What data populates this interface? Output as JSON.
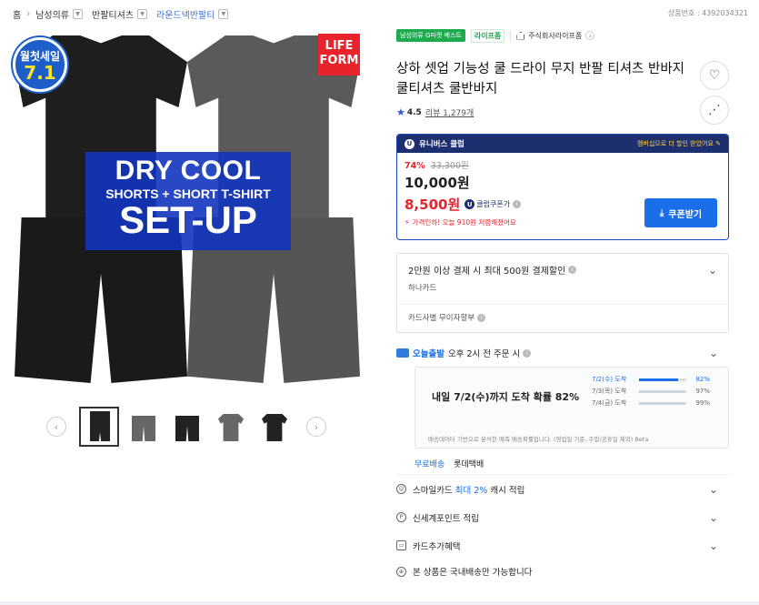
{
  "nav": {
    "breadcrumb": [
      {
        "label": "홈"
      },
      {
        "label": "남성의류"
      },
      {
        "label": "반팔티셔츠"
      },
      {
        "label": "라운드넥반팔티"
      }
    ]
  },
  "product": {
    "code_label": "상품번호 : 4392034321",
    "title": "상하 셋업 기능성 쿨 드라이 무지 반팔 티셔츠 반바지 쿨티셔츠 쿨반바지",
    "rating": "4.5",
    "review_label": "리뷰 1,279개",
    "tag_best": "남성의류 G마켓 베스트",
    "tag_brand": "라이프폼",
    "store_name": "주식회사라이프폼"
  },
  "image": {
    "sale_badge_top": "월첫세일",
    "sale_badge_num": "7.1",
    "life_badge_1": "LIFE",
    "life_badge_2": "FORM",
    "banner_1": "DRY COOL",
    "banner_2": "SHORTS + SHORT T-SHIRT",
    "banner_3": "SET-UP"
  },
  "price": {
    "club_label": "유니버스 클럽",
    "club_more": "멤버십으로 더 할인 받았어요 ✎",
    "discount_pct": "74%",
    "original": "33,300원",
    "current": "10,000원",
    "final": "8,500원",
    "club_coupon": "클럽쿠폰가",
    "warning": "가격인하! 오늘 910원 저렴해졌어요",
    "coupon_button": "쿠폰받기"
  },
  "card": {
    "title": "2만원 이상 결제 시 최대 500원 결제할인",
    "issuer": "하나카드",
    "installment": "카드사별 무이자할부"
  },
  "delivery": {
    "tag": "오늘출발",
    "cutoff": "오후 2시 전 주문 시",
    "summary": "내일 7/2(수)까지 도착 확률 82%",
    "rows": [
      {
        "date": "7/2(수) 도착",
        "pct_label": "82%",
        "pct": 82
      },
      {
        "date": "7/3(목) 도착",
        "pct_label": "97%",
        "pct": 97
      },
      {
        "date": "7/4(금) 도착",
        "pct_label": "99%",
        "pct": 99
      }
    ],
    "note": "배송데이터 기반으로 분석한 예측 배송확률입니다. (영업일 기준, 주말/공휴일 제외) Beta",
    "shipping_free": "무료배송",
    "carrier": "롯데택배"
  },
  "benefits": {
    "smile_prefix": "스마일카드",
    "smile_highlight": "최대 2%",
    "smile_suffix": "캐시 적립",
    "shinsegae": "신세계포인트 적립",
    "card_extra": "카드추가혜택",
    "domestic": "본 상품은 국내배송만 가능합니다"
  },
  "colors": {
    "accent_blue": "#1a6fe8",
    "sale_red": "#e8232b",
    "club_navy": "#1d2f6f",
    "best_green": "#1eaa4f"
  }
}
